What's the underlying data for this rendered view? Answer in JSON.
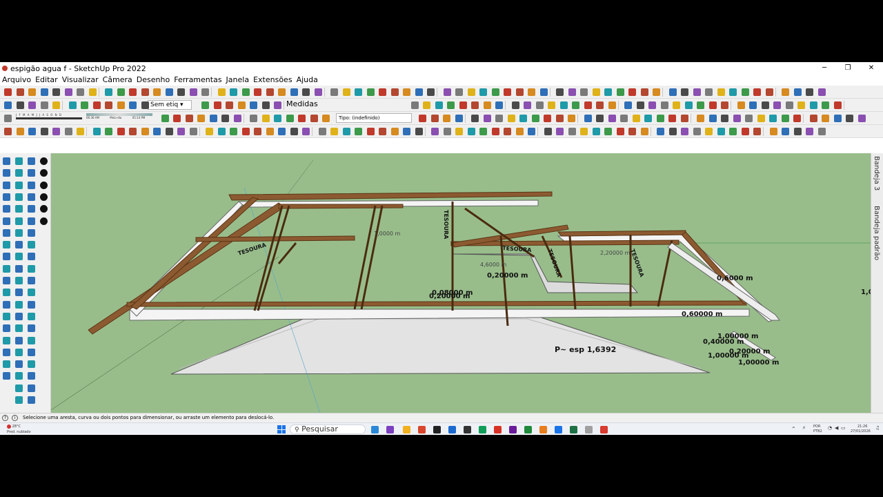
{
  "window": {
    "title": "espigão agua f - SketchUp Pro 2022",
    "controls": [
      "─",
      "❐",
      "✕"
    ]
  },
  "menu": [
    "Arquivo",
    "Editar",
    "Visualizar",
    "Câmera",
    "Desenho",
    "Ferramentas",
    "Janela",
    "Extensões",
    "Ajuda"
  ],
  "toolbar2": {
    "tag_select": "Sem etiq",
    "measures_label": "Medidas"
  },
  "toolbar3": {
    "type_field": "Tipo: (indefinido)",
    "months": "J F M A M J J A S O N D",
    "time_start": "06:36 AM",
    "time_mid": "Meio-dia",
    "time_end": "05:14 PM"
  },
  "tray": {
    "tabs": [
      "Bandeja 3",
      "Bandeja padrão"
    ]
  },
  "viewport": {
    "background": "#98bd8b",
    "labels": {
      "dim1": "0,20000 m",
      "dim2": "0,08000 m",
      "dim3": "0,20000 m",
      "dim4": "0,6000 m",
      "dim5": "0,60000 m",
      "dim6": "2,20000 m",
      "dim7": "1,00000 m",
      "dim8": "0,40000 m",
      "dim9": "1,00000 m",
      "dim10": "0,20000 m",
      "dim11": "1,00000 m",
      "dim12": "1,0",
      "dim13": "4,6000 m",
      "dim14": "1,0000 m",
      "tesoura1": "TESOURA",
      "tesoura2": "TESOURA",
      "tesoura3": "TESOURA",
      "tesoura4": "TESOURA",
      "tesoura5": "TESOURA",
      "area": "P~ esp 1,6392"
    }
  },
  "status": {
    "message": "Selecione uma aresta, curva ou dois pontos para dimensionar, ou arraste um elemento para deslocá-lo."
  },
  "taskbar": {
    "weather_temp": "28°C",
    "weather_desc": "Pred. nublado",
    "search": "Pesquisar",
    "lang1": "POR",
    "lang2": "PTB2",
    "time": "21:26",
    "date": "27/01/2026"
  }
}
